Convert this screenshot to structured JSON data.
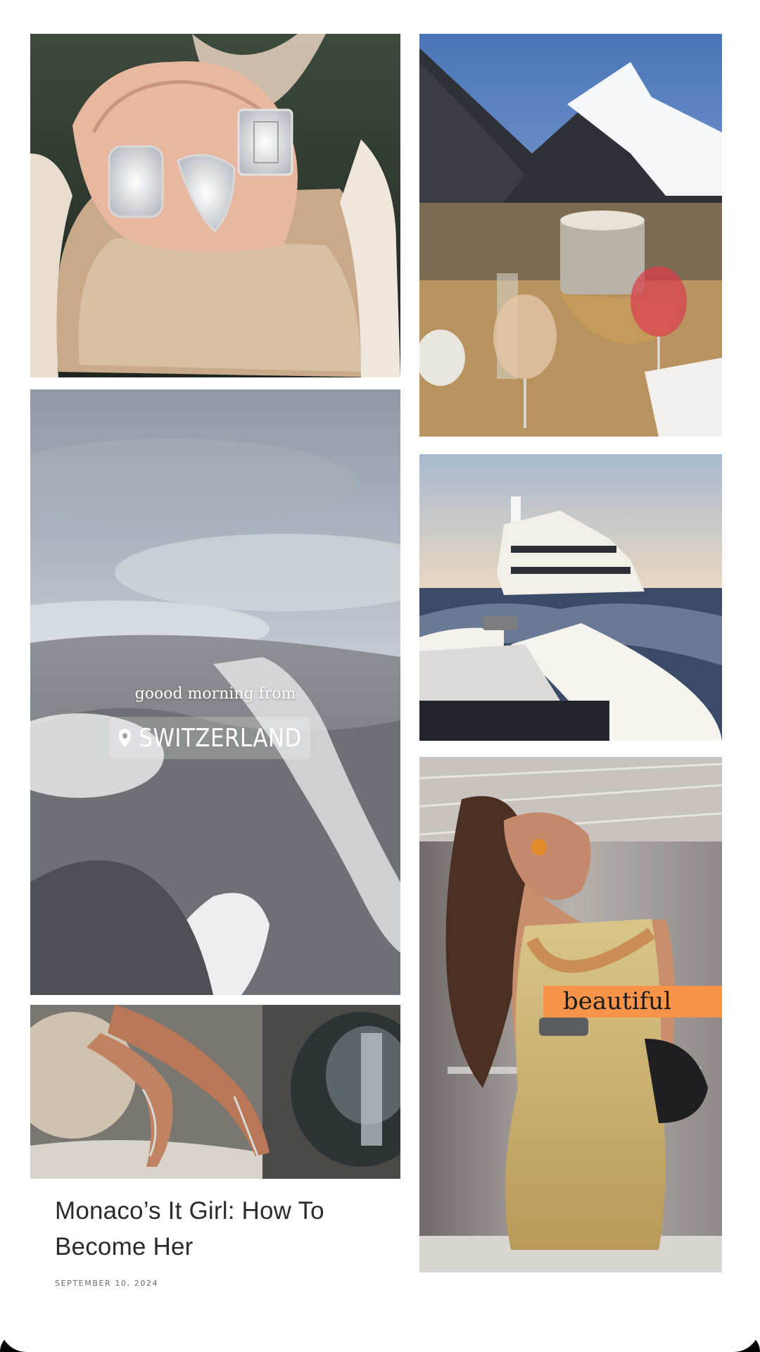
{
  "gallery": {
    "images": [
      {
        "name": "rings-photo",
        "description_label": "rings"
      },
      {
        "name": "switzerland-photo"
      },
      {
        "name": "legs-heels-photo"
      },
      {
        "name": "matterhorn-table-photo"
      },
      {
        "name": "yacht-photo"
      },
      {
        "name": "gold-dress-photo"
      }
    ],
    "overlays": {
      "morning_text": "goood morning from",
      "place_text": "SWITZERLAND",
      "beautiful_tag": "beautiful"
    }
  },
  "post": {
    "title": "Monaco’s It Girl: How To Become Her",
    "date": "SEPTEMBER 10, 2024"
  },
  "colors": {
    "accent_tag": "#f7944a",
    "title": "#2b2b2b",
    "date": "#6a6a6a"
  }
}
